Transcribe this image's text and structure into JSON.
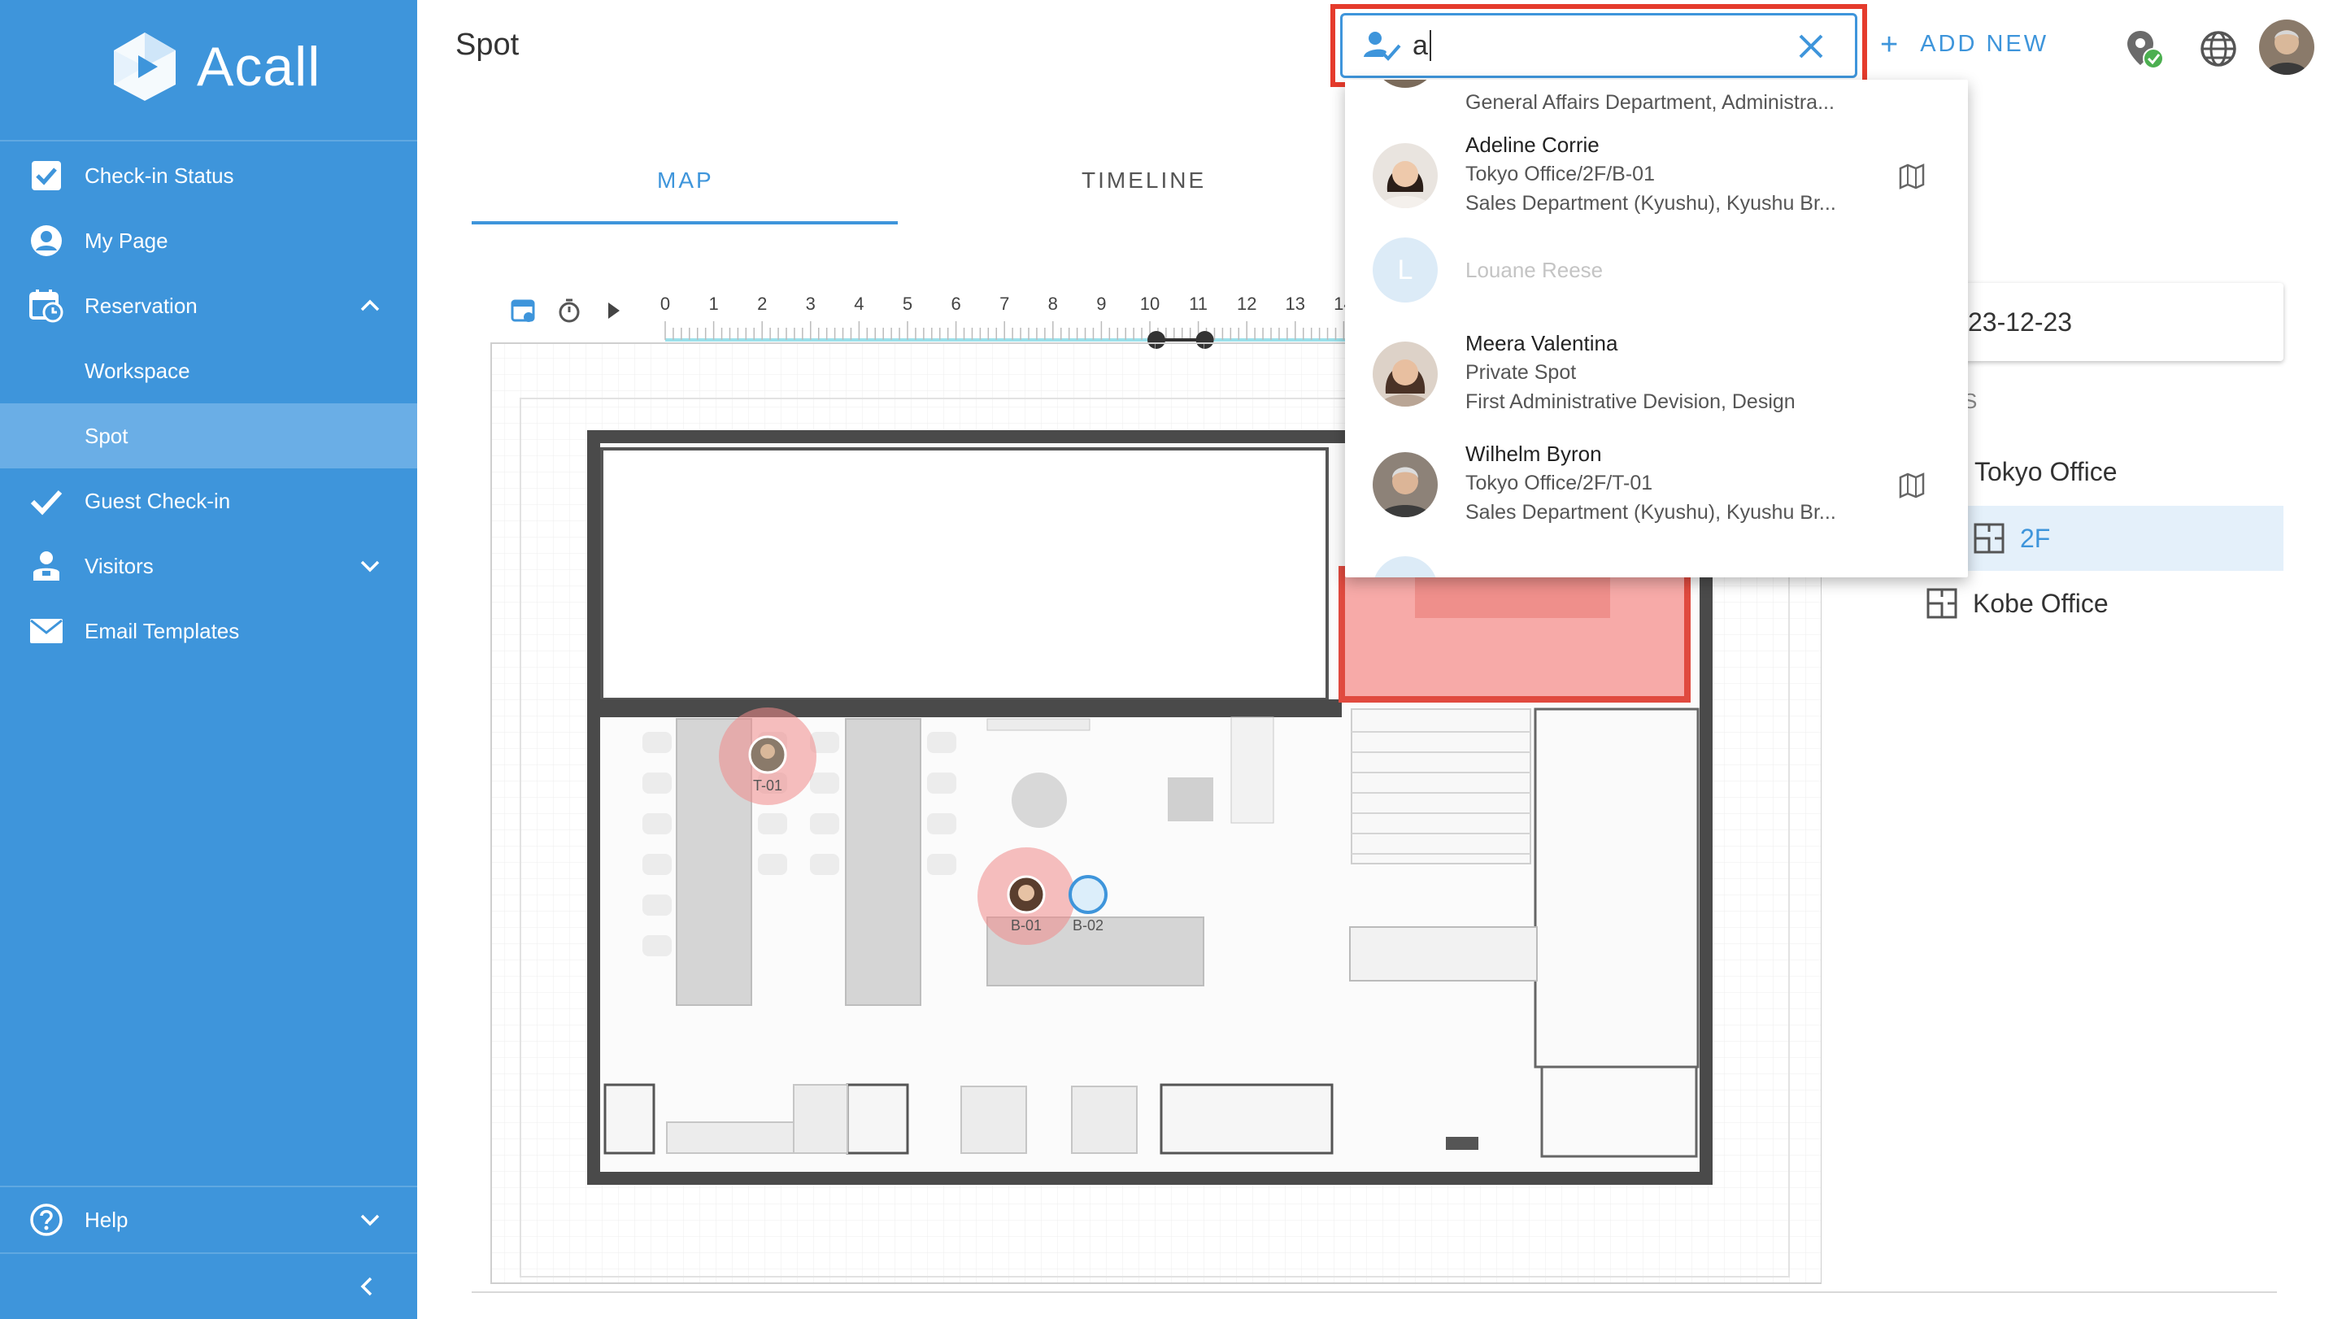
{
  "app": {
    "name": "Acall"
  },
  "sidebar": {
    "items": [
      {
        "label": "Check-in Status",
        "icon": "checkbox-icon"
      },
      {
        "label": "My Page",
        "icon": "user-circle-icon"
      },
      {
        "label": "Reservation",
        "icon": "calendar-clock-icon",
        "expanded": true
      },
      {
        "label": "Guest Check-in",
        "icon": "checkmark-icon"
      },
      {
        "label": "Visitors",
        "icon": "visitor-icon",
        "expanded": false
      },
      {
        "label": "Email Templates",
        "icon": "envelope-icon"
      }
    ],
    "sub_items": [
      {
        "label": "Workspace",
        "active": false
      },
      {
        "label": "Spot",
        "active": true
      }
    ],
    "help": {
      "label": "Help",
      "icon": "question-circle-icon"
    }
  },
  "header": {
    "title": "Spot",
    "search": {
      "value": "a",
      "icon": "user-search-icon"
    },
    "add_new": "ADD NEW",
    "icons": [
      "location-check-icon",
      "globe-icon"
    ]
  },
  "tabs": [
    {
      "label": "MAP",
      "active": true
    },
    {
      "label": "TIMELINE",
      "active": false
    }
  ],
  "timeline": {
    "hours": [
      "0",
      "1",
      "2",
      "3",
      "4",
      "5",
      "6",
      "7",
      "8",
      "9",
      "10",
      "11",
      "12",
      "13",
      "14"
    ],
    "range_start_hour": 10,
    "range_end_hour": 11
  },
  "map": {
    "seats": [
      {
        "label": "T-01",
        "occupied": true
      },
      {
        "label": "B-01",
        "occupied": true
      },
      {
        "label": "B-02",
        "occupied": false
      }
    ]
  },
  "right_panel": {
    "date": "23-12-23",
    "section_label": "S",
    "locations": [
      {
        "label": "Tokyo Office",
        "selected": false,
        "indent": false
      },
      {
        "label": "2F",
        "selected": true,
        "indent": true
      },
      {
        "label": "Kobe Office",
        "selected": false,
        "indent": false
      }
    ]
  },
  "dropdown": {
    "results": [
      {
        "name": "",
        "line1": "General Affairs Department, Administra...",
        "line2": "",
        "partial": true
      },
      {
        "name": "Adeline Corrie",
        "line1": "Tokyo Office/2F/B-01",
        "line2": "Sales Department (Kyushu), Kyushu Br...",
        "has_map": true
      },
      {
        "name": "Louane Reese",
        "initial": "L",
        "disabled": true
      },
      {
        "name": "Meera Valentina",
        "line1": "Private Spot",
        "line2": "First Administrative Devision, Design",
        "has_map": false
      },
      {
        "name": "Wilhelm Byron",
        "line1": "Tokyo Office/2F/T-01",
        "line2": "Sales Department (Kyushu), Kyushu Br...",
        "has_map": true
      }
    ]
  },
  "colors": {
    "sidebar": "#3e95db",
    "sidebar_active": "#6aaee6",
    "accent": "#3e95db",
    "highlight_box": "#e53b2c",
    "occupied_seat": "#f08a8a"
  }
}
